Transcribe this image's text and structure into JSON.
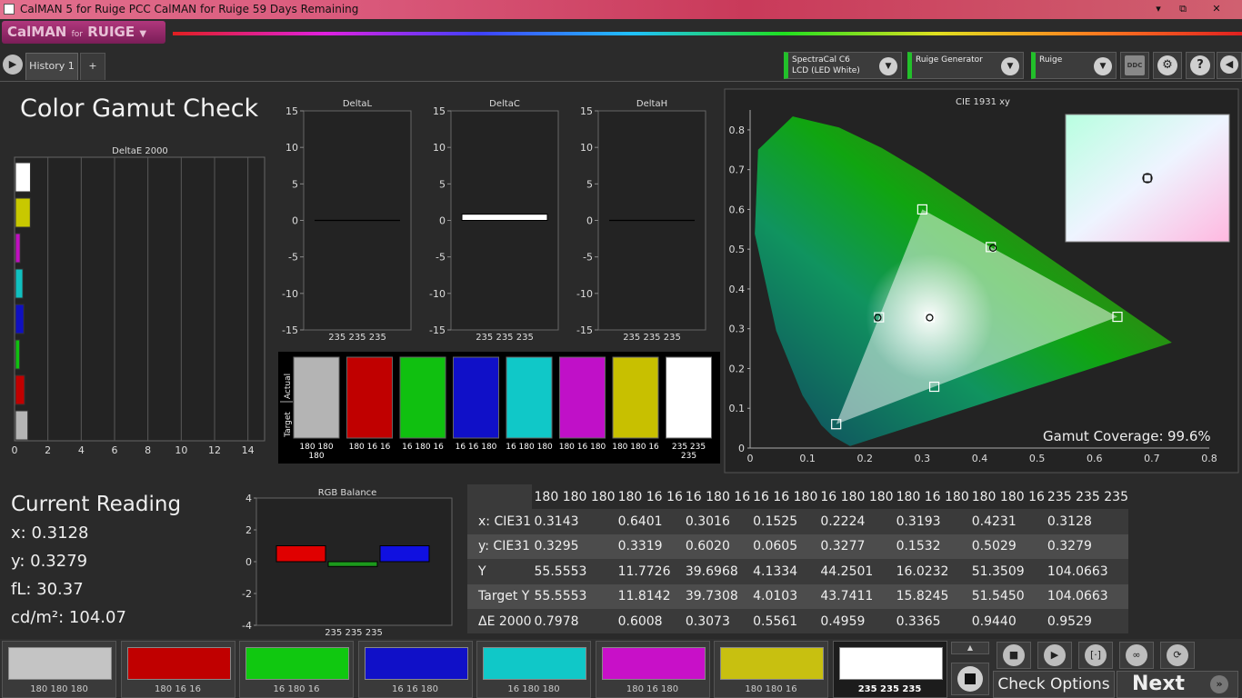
{
  "window": {
    "title": "CalMAN 5 for Ruige PCC CalMAN for Ruige 59 Days Remaining",
    "logo": "CalMAN",
    "logo_sub": "for",
    "logo_brand": "RUIGE"
  },
  "window_controls": {
    "minimize": "▾",
    "restore": "⧉",
    "close": "✕"
  },
  "tabs": {
    "history": "History 1",
    "add": "+"
  },
  "devices": {
    "meter": {
      "line1": "SpectraCal C6",
      "line2": "LCD (LED White)"
    },
    "generator": {
      "line1": "Ruige Generator"
    },
    "display": {
      "line1": "Ruige"
    },
    "ddc": "DDC"
  },
  "page_title": "Color Gamut Check",
  "colors": {
    "white": "#ffffff",
    "red": "#c00000",
    "green": "#10c010",
    "blue": "#1010c0",
    "cyan": "#10c0c0",
    "magenta": "#c010c0",
    "yellow": "#c0c010",
    "gray": "#b4b4b4"
  },
  "deltae_chart": {
    "title": "DeltaE 2000",
    "x_ticks": [
      "0",
      "2",
      "4",
      "6",
      "8",
      "10",
      "12",
      "14"
    ],
    "xlim": [
      0,
      15
    ],
    "bars": [
      {
        "name": "white",
        "value": 0.9529,
        "color": "#ffffff"
      },
      {
        "name": "yellow",
        "value": 0.944,
        "color": "#c8c800"
      },
      {
        "name": "magenta",
        "value": 0.3365,
        "color": "#c010c0"
      },
      {
        "name": "cyan",
        "value": 0.4959,
        "color": "#10c0c0"
      },
      {
        "name": "blue",
        "value": 0.5561,
        "color": "#1010c0"
      },
      {
        "name": "green",
        "value": 0.3073,
        "color": "#10c010"
      },
      {
        "name": "red",
        "value": 0.6008,
        "color": "#c00000"
      },
      {
        "name": "gray",
        "value": 0.7978,
        "color": "#b4b4b4"
      }
    ]
  },
  "delta_charts": [
    {
      "title": "DeltaL",
      "label": "235 235 235",
      "value": 0.0,
      "ticks": [
        "15",
        "10",
        "5",
        "0",
        "-5",
        "-10",
        "-15"
      ]
    },
    {
      "title": "DeltaC",
      "label": "235 235 235",
      "value": 0.6,
      "ticks": [
        "15",
        "10",
        "5",
        "0",
        "-5",
        "-10",
        "-15"
      ]
    },
    {
      "title": "DeltaH",
      "label": "235 235 235",
      "value": 0.0,
      "ticks": [
        "15",
        "10",
        "5",
        "0",
        "-5",
        "-10",
        "-15"
      ]
    }
  ],
  "swatch_panel": {
    "actual_label": "Actual",
    "target_label": "Target",
    "swatches": [
      {
        "label": "180 180 180",
        "color": "#b4b4b4"
      },
      {
        "label": "180 16 16",
        "color": "#c00000"
      },
      {
        "label": "16 180 16",
        "color": "#10c010"
      },
      {
        "label": "16 16 180",
        "color": "#1010c8"
      },
      {
        "label": "16 180 180",
        "color": "#10c8c8"
      },
      {
        "label": "180 16 180",
        "color": "#c010c8"
      },
      {
        "label": "180 180 16",
        "color": "#c8c000"
      },
      {
        "label": "235 235 235",
        "color": "#ffffff"
      }
    ]
  },
  "cie_chart": {
    "title": "CIE 1931 xy",
    "x_ticks": [
      "0",
      "0.1",
      "0.2",
      "0.3",
      "0.4",
      "0.5",
      "0.6",
      "0.7",
      "0.8"
    ],
    "y_ticks": [
      "0.8",
      "0.7",
      "0.6",
      "0.5",
      "0.4",
      "0.3",
      "0.2",
      "0.1",
      "0"
    ],
    "xlim": [
      0,
      0.8
    ],
    "ylim": [
      0,
      0.85
    ],
    "gamut_coverage_label": "Gamut Coverage:",
    "gamut_coverage_value": "99.6%",
    "targets": [
      {
        "name": "red",
        "x": 0.64,
        "y": 0.33
      },
      {
        "name": "green",
        "x": 0.3,
        "y": 0.6
      },
      {
        "name": "blue",
        "x": 0.15,
        "y": 0.06
      },
      {
        "name": "white",
        "x": 0.3127,
        "y": 0.329
      },
      {
        "name": "cyan",
        "x": 0.2246,
        "y": 0.3287
      },
      {
        "name": "magenta",
        "x": 0.3209,
        "y": 0.1542
      },
      {
        "name": "yellow",
        "x": 0.4193,
        "y": 0.5053
      }
    ],
    "measured": [
      {
        "name": "cyan",
        "x": 0.2224,
        "y": 0.3277
      },
      {
        "name": "white",
        "x": 0.3128,
        "y": 0.3279
      },
      {
        "name": "yellow",
        "x": 0.4231,
        "y": 0.5029
      }
    ]
  },
  "current_reading": {
    "title": "Current Reading",
    "x": "x: 0.3128",
    "y": "y: 0.3279",
    "fl": "fL: 30.37",
    "cdm2": "cd/m²: 104.07"
  },
  "rgb_balance": {
    "title": "RGB Balance",
    "label": "235 235 235",
    "y_ticks": [
      "4",
      "2",
      "0",
      "-2",
      "-4"
    ],
    "ylim": [
      -4,
      4
    ],
    "bars": [
      {
        "name": "red",
        "value": 1.0,
        "color": "#e00000"
      },
      {
        "name": "green",
        "value": -0.3,
        "color": "#1c9a1c"
      },
      {
        "name": "blue",
        "value": 1.0,
        "color": "#1010e0"
      }
    ]
  },
  "table": {
    "columns": [
      "180 180 180",
      "180 16 16",
      "16 180 16",
      "16 16 180",
      "16 180 180",
      "180 16 180",
      "180 180 16",
      "235 235 235"
    ],
    "rows": [
      {
        "label": "x: CIE31",
        "values": [
          "0.3143",
          "0.6401",
          "0.3016",
          "0.1525",
          "0.2224",
          "0.3193",
          "0.4231",
          "0.3128"
        ]
      },
      {
        "label": "y: CIE31",
        "values": [
          "0.3295",
          "0.3319",
          "0.6020",
          "0.0605",
          "0.3277",
          "0.1532",
          "0.5029",
          "0.3279"
        ]
      },
      {
        "label": "Y",
        "values": [
          "55.5553",
          "11.7726",
          "39.6968",
          "4.1334",
          "44.2501",
          "16.0232",
          "51.3509",
          "104.0663"
        ]
      },
      {
        "label": "Target Y",
        "values": [
          "55.5553",
          "11.8142",
          "39.7308",
          "4.0103",
          "43.7411",
          "15.8245",
          "51.5450",
          "104.0663"
        ]
      },
      {
        "label": "ΔE 2000",
        "values": [
          "0.7978",
          "0.6008",
          "0.3073",
          "0.5561",
          "0.4959",
          "0.3365",
          "0.9440",
          "0.9529"
        ]
      }
    ]
  },
  "patches": [
    {
      "label": "180 180 180",
      "color": "#c4c4c4"
    },
    {
      "label": "180 16 16",
      "color": "#c00000"
    },
    {
      "label": "16 180 16",
      "color": "#10c810"
    },
    {
      "label": "16 16 180",
      "color": "#1010c8"
    },
    {
      "label": "16 180 180",
      "color": "#10c8c8"
    },
    {
      "label": "180 16 180",
      "color": "#c810c8"
    },
    {
      "label": "180 180 16",
      "color": "#c8c010"
    },
    {
      "label": "235 235 235",
      "color": "#ffffff",
      "selected": true
    }
  ],
  "controls": {
    "check_options": "Check Options",
    "next": "Next",
    "next_icon": "»"
  }
}
